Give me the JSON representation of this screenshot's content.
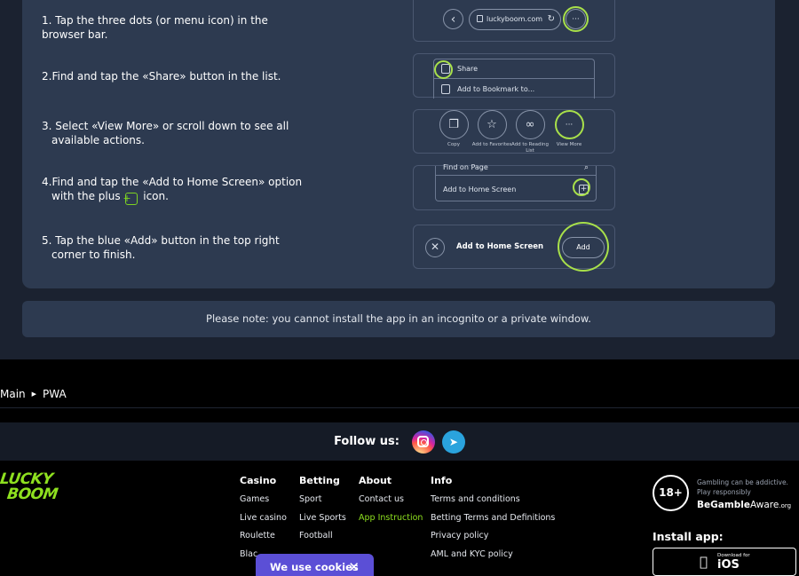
{
  "steps": [
    {
      "text": "1. Tap the three dots (or menu icon) in the browser bar."
    },
    {
      "text": "2.Find and tap the «Share» button in the list."
    },
    {
      "text": "3. Select «View More» or scroll down to see all available actions."
    },
    {
      "text_before": "4.Find and tap the «Add to Home Screen» option with the plus",
      "plus_glyph": "+",
      "text_after": "icon."
    },
    {
      "text": "5. Tap the blue «Add» button in the top right corner to finish."
    }
  ],
  "illustration1": {
    "url": "luckyboom.com",
    "back_glyph": "‹",
    "reload_glyph": "↻",
    "menu_glyph": "···"
  },
  "illustration2": {
    "share_label": "Share",
    "bookmark_label": "Add to Bookmark to..."
  },
  "illustration3": {
    "actions": [
      {
        "label": "Copy",
        "glyph": "❐"
      },
      {
        "label": "Add to Favorites",
        "glyph": "☆"
      },
      {
        "label": "Add to Reading List",
        "glyph": "∞"
      },
      {
        "label": "View More",
        "glyph": "···"
      }
    ]
  },
  "illustration4": {
    "find_label": "Find on Page",
    "add_home_label": "Add to Home Screen",
    "search_glyph": "⌕",
    "plus_glyph": "+"
  },
  "illustration5": {
    "title": "Add to Home Screen",
    "add_label": "Add",
    "close_glyph": "✕"
  },
  "note": "Please note: you cannot install the app in an incognito or a private window.",
  "breadcrumb": {
    "home": "Main",
    "current": "PWA",
    "arrow": "▶"
  },
  "follow": {
    "label": "Follow us:",
    "telegram_glyph": "➤"
  },
  "logo": {
    "line1": "LUCKY",
    "line2": "BOOM"
  },
  "footer": {
    "casino": {
      "head": "Casino",
      "links": [
        "Games",
        "Live casino",
        "Roulette",
        "Blac"
      ]
    },
    "betting": {
      "head": "Betting",
      "links": [
        "Sport",
        "Live Sports",
        "Football"
      ]
    },
    "about": {
      "head": "About",
      "links": [
        "Contact us",
        "App Instruction"
      ]
    },
    "info": {
      "head": "Info",
      "links": [
        "Terms and conditions",
        "Betting Terms and Definitions",
        "Privacy policy",
        "AML and KYC policy"
      ]
    }
  },
  "responsible": {
    "age": "18+",
    "line1": "Gambling can be addictive.",
    "line2": "Play responsibly",
    "begamble_be": "BeGamble",
    "begamble_aware": "Aware",
    "begamble_org": ".org"
  },
  "install": {
    "label": "Install app:",
    "ios_small": "Download for",
    "ios_big": "iOS"
  },
  "cookie": {
    "label": "We use cookies",
    "close_glyph": "✕"
  },
  "colors": {
    "accent": "#8ee01f",
    "ring": "#a8e04a",
    "panel": "#2d3a50",
    "cookie": "#5b4fd6"
  }
}
